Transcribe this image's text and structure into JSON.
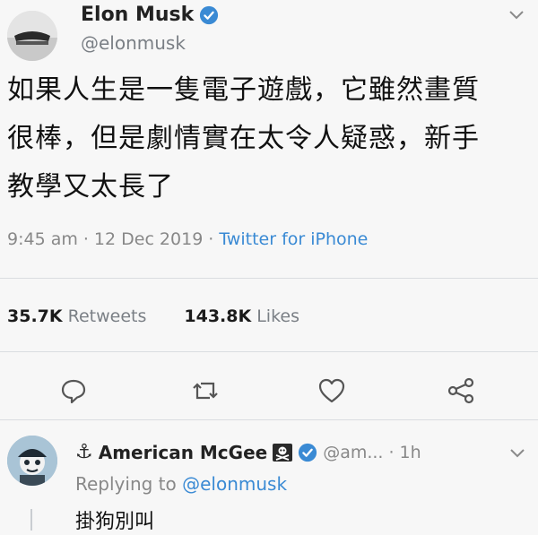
{
  "tweet": {
    "display_name": "Elon Musk",
    "handle": "@elonmusk",
    "text_line1": "如果人生是一隻電子遊戲，它雖然畫質",
    "text_line2": "很棒，但是劇情實在太令人疑惑，新手",
    "text_line3": "教學又太長了",
    "time": "9:45 am",
    "date": "12 Dec 2019",
    "source": "Twitter for iPhone",
    "retweets_count": "35.7K",
    "retweets_label": "Retweets",
    "likes_count": "143.8K",
    "likes_label": "Likes",
    "sep": "·"
  },
  "icons": {
    "verified": "verified-badge-icon",
    "caret": "chevron-down-icon",
    "reply": "reply-bubble-icon",
    "retweet": "retweet-icon",
    "like": "heart-icon",
    "share": "share-icon",
    "anchor": "anchor-icon",
    "pirate": "skull-crossbones-icon"
  },
  "colors": {
    "link": "#3a8ad4",
    "verified": "#3a8ad4",
    "muted": "#888888",
    "background": "#f7f7f7"
  },
  "reply": {
    "anchor_glyph": "⚓",
    "display_name": "American McGee",
    "handle": "@am...",
    "time": "1h",
    "sep": "·",
    "replying_prefix": "Replying to",
    "replying_handle": "@elonmusk",
    "text": "掛狗別叫"
  }
}
